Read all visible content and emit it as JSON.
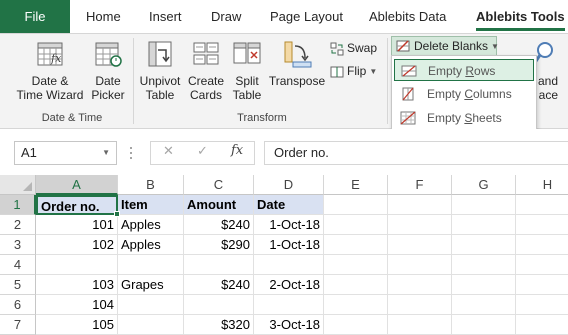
{
  "ribbon_tabs": [
    "File",
    "Home",
    "Insert",
    "Draw",
    "Page Layout",
    "Ablebits Data",
    "Ablebits Tools"
  ],
  "ribbon": {
    "date_time_wizard": "Date &\nTime Wizard",
    "date_picker": "Date\nPicker",
    "group_date_time": "Date & Time",
    "unpivot_table": "Unpivot\nTable",
    "create_cards": "Create\nCards",
    "split_table": "Split\nTable",
    "transpose": "Transpose",
    "swap": "Swap",
    "flip": "Flip",
    "group_transform": "Transform",
    "delete_blanks": "Delete Blanks",
    "partial_and": "and",
    "partial_ace": "ace"
  },
  "dropdown": {
    "items": [
      "Empty Rows",
      "Empty Columns",
      "Empty Sheets"
    ],
    "highlighted": "Empty Rows"
  },
  "formula_bar": {
    "name_box": "A1",
    "cancel_icon": "✕",
    "enter_icon": "✓",
    "fx_label": "fx",
    "value": "Order no."
  },
  "sheet": {
    "columns": [
      "A",
      "B",
      "C",
      "D",
      "E",
      "F",
      "G",
      "H"
    ],
    "rows": [
      "1",
      "2",
      "3",
      "4",
      "5",
      "6",
      "7"
    ],
    "cells": [
      [
        "Order no.",
        "Item",
        "Amount",
        "Date"
      ],
      [
        "101",
        "Apples",
        "$240",
        "1-Oct-18"
      ],
      [
        "102",
        "Apples",
        "$290",
        "1-Oct-18"
      ],
      [
        "",
        "",
        "",
        ""
      ],
      [
        "103",
        "Grapes",
        "$240",
        "2-Oct-18"
      ],
      [
        "104",
        "",
        "",
        ""
      ],
      [
        "105",
        "",
        "$320",
        "3-Oct-18"
      ]
    ],
    "active_cell": "A1"
  },
  "colors": {
    "accent": "#217346",
    "header_fill": "#d9e1f2",
    "highlight": "#ddf0e4"
  }
}
